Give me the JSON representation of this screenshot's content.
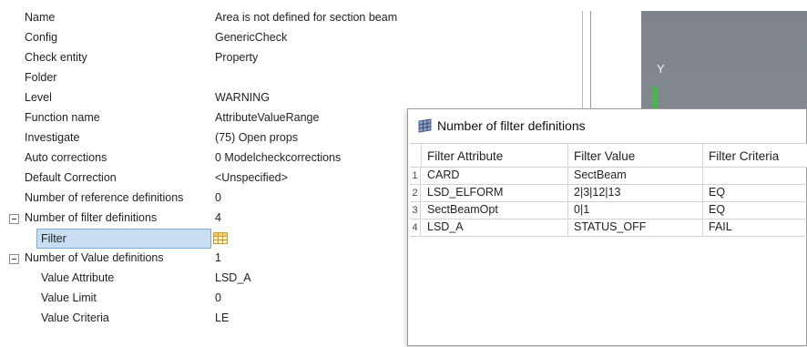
{
  "properties": [
    {
      "name": "Name",
      "value": "Area is not defined for section beam"
    },
    {
      "name": "Config",
      "value": "GenericCheck"
    },
    {
      "name": "Check entity",
      "value": "Property"
    },
    {
      "name": "Folder",
      "value": ""
    },
    {
      "name": "Level",
      "value": "WARNING"
    },
    {
      "name": "Function name",
      "value": "AttributeValueRange"
    },
    {
      "name": "Investigate",
      "value": "(75) Open props"
    },
    {
      "name": "Auto corrections",
      "value": "0 Modelcheckcorrections"
    },
    {
      "name": "Default Correction",
      "value": "<Unspecified>"
    },
    {
      "name": "Number of reference definitions",
      "value": "0"
    },
    {
      "name": "Number of filter definitions",
      "value": "4"
    },
    {
      "name": "Filter",
      "value": ""
    },
    {
      "name": "Number of Value definitions",
      "value": "1"
    },
    {
      "name": "Value Attribute",
      "value": "LSD_A"
    },
    {
      "name": "Value Limit",
      "value": "0"
    },
    {
      "name": "Value Criteria",
      "value": "LE"
    }
  ],
  "viewport": {
    "axis_label": "Y",
    "axis_color": "#3fbf3f"
  },
  "popup": {
    "title": "Number of filter definitions",
    "columns": [
      "Filter Attribute",
      "Filter Value",
      "Filter Criteria"
    ],
    "rows": [
      {
        "num": "1",
        "attribute": "CARD",
        "value": "SectBeam",
        "criteria": ""
      },
      {
        "num": "2",
        "attribute": "LSD_ELFORM",
        "value": "2|3|12|13",
        "criteria": "EQ"
      },
      {
        "num": "3",
        "attribute": "SectBeamOpt",
        "value": "0|1",
        "criteria": "EQ"
      },
      {
        "num": "4",
        "attribute": "LSD_A",
        "value": "STATUS_OFF",
        "criteria": "FAIL"
      }
    ]
  },
  "colors": {
    "selection": "#c8ddf1",
    "viewport_bg": "#858a92"
  }
}
